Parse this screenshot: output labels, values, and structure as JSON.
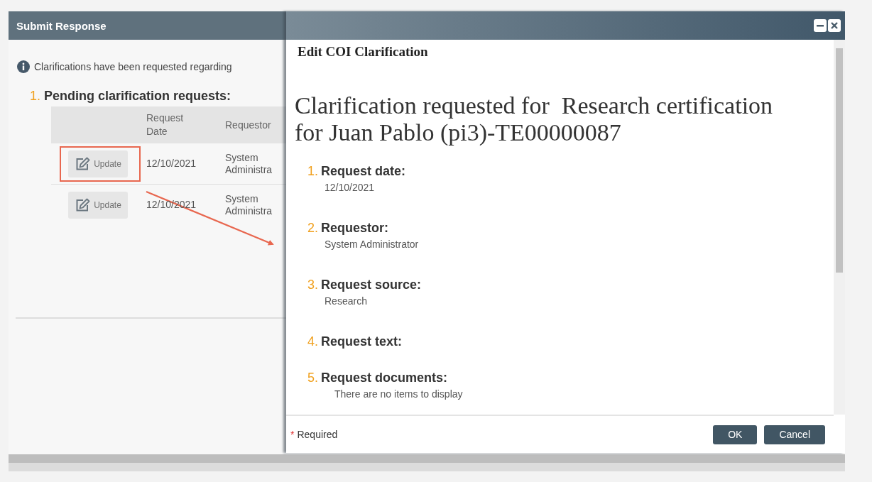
{
  "background_window": {
    "title": "Submit Response",
    "info": "Clarifications have been requested regarding",
    "section": {
      "number": "1.",
      "label": "Pending clarification requests:"
    },
    "table": {
      "columns": [
        "Request Date",
        "Requestor"
      ],
      "rows": [
        {
          "action": "Update",
          "highlighted": true,
          "request_date": "12/10/2021",
          "requestor": "System Administra"
        },
        {
          "action": "Update",
          "highlighted": false,
          "request_date": "12/10/2021",
          "requestor": "System Administra"
        }
      ]
    }
  },
  "dialog": {
    "title": "Edit COI Clarification",
    "heading": "Clarification requested for  Research certification for Juan Pablo (pi3)-TE00000087",
    "fields": [
      {
        "number": "1.",
        "label": "Request date:",
        "value": "12/10/2021",
        "kind": "text"
      },
      {
        "number": "2.",
        "label": "Requestor:",
        "value": "System Administrator",
        "kind": "text"
      },
      {
        "number": "3.",
        "label": "Request source:",
        "value": "Research",
        "kind": "text"
      },
      {
        "number": "4.",
        "label": "Request text:"
      },
      {
        "number": "5.",
        "label": "Request documents:",
        "value": "There are no items to display",
        "kind": "list"
      }
    ],
    "footer": {
      "required_mark": "*",
      "required_label": "Required",
      "buttons": [
        {
          "label": "OK"
        },
        {
          "label": "Cancel"
        }
      ]
    }
  }
}
